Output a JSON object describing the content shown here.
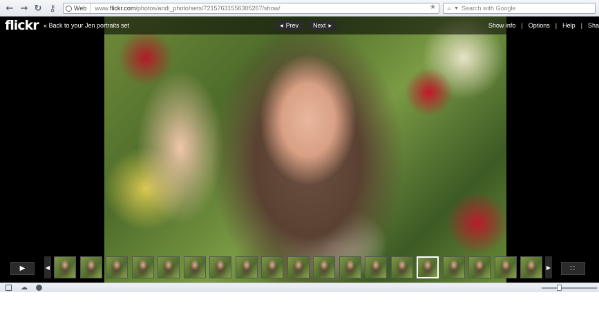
{
  "browser": {
    "back_icon": "←",
    "forward_icon": "→",
    "reload_icon": "↻",
    "key_icon": "⚷",
    "web_label": "Web",
    "url_prefix": "www.",
    "url_host": "flickr.com",
    "url_path": "/photos/andi_photo/sets/72157631556305267/show/",
    "search_placeholder": "Search with Google"
  },
  "slideshow": {
    "logo": "flickr",
    "back_link": "« Back to your Jen portraits set",
    "prev_label": "Prev",
    "next_label": "Next",
    "menu": [
      "Show info",
      "Options",
      "Help",
      "Sha"
    ],
    "separator": "|",
    "thumbnail_count": 19,
    "selected_thumbnail": 15
  }
}
